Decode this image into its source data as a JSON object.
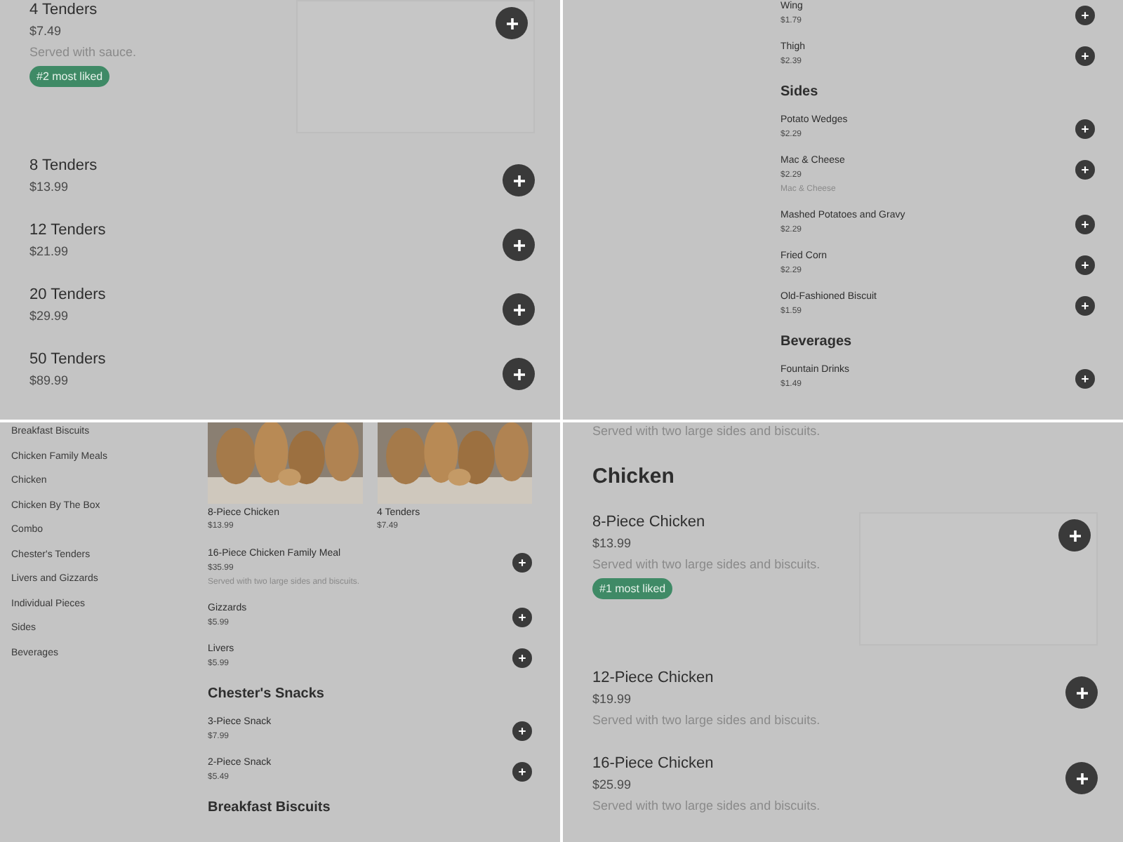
{
  "panels": [
    {
      "kind": "large",
      "sections": [
        {
          "kind": "list",
          "items": [
            {
              "name": "4 Tenders",
              "price": "$7.49",
              "description": "Served with sauce.",
              "badge": "#2 most liked",
              "image": true
            },
            {
              "name": "8 Tenders",
              "price": "$13.99"
            },
            {
              "name": "12 Tenders",
              "price": "$21.99"
            },
            {
              "name": "20 Tenders",
              "price": "$29.99"
            },
            {
              "name": "50 Tenders",
              "price": "$89.99"
            }
          ]
        }
      ]
    },
    {
      "kind": "small",
      "sections": [
        {
          "kind": "list",
          "items": [
            {
              "name": "Wing",
              "price": "$1.79"
            },
            {
              "name": "Thigh",
              "price": "$2.39"
            }
          ]
        },
        {
          "kind": "list",
          "title": "Sides",
          "items": [
            {
              "name": "Potato Wedges",
              "price": "$2.29"
            },
            {
              "name": "Mac & Cheese",
              "price": "$2.29",
              "description": "Mac & Cheese"
            },
            {
              "name": "Mashed Potatoes and Gravy",
              "price": "$2.29"
            },
            {
              "name": "Fried Corn",
              "price": "$2.29"
            },
            {
              "name": "Old-Fashioned Biscuit",
              "price": "$1.59"
            }
          ]
        },
        {
          "kind": "list",
          "title": "Beverages",
          "items": [
            {
              "name": "Fountain Drinks",
              "price": "$1.49"
            }
          ]
        }
      ]
    },
    {
      "kind": "small",
      "sidebar": [
        "Breakfast Biscuits",
        "Chicken Family Meals",
        "Chicken",
        "Chicken By The Box",
        "Combo",
        "Chester's Tenders",
        "Livers and Gizzards",
        "Individual Pieces",
        "Sides",
        "Beverages"
      ],
      "sections": [
        {
          "kind": "photos",
          "items": [
            {
              "name": "8-Piece Chicken",
              "price": "$13.99"
            },
            {
              "name": "4 Tenders",
              "price": "$7.49"
            }
          ]
        },
        {
          "kind": "list",
          "items": [
            {
              "name": "16-Piece Chicken Family Meal",
              "price": "$35.99",
              "description": "Served with two large sides and biscuits."
            },
            {
              "name": "Gizzards",
              "price": "$5.99"
            },
            {
              "name": "Livers",
              "price": "$5.99"
            }
          ]
        },
        {
          "kind": "list",
          "title": "Chester's Snacks",
          "items": [
            {
              "name": "3-Piece Snack",
              "price": "$7.99"
            },
            {
              "name": "2-Piece Snack",
              "price": "$5.49"
            }
          ]
        },
        {
          "kind": "list",
          "title": "Breakfast Biscuits"
        }
      ]
    },
    {
      "kind": "large",
      "sections": [
        {
          "kind": "note",
          "text": "Served with two large sides and biscuits."
        },
        {
          "kind": "list",
          "title": "Chicken",
          "items": [
            {
              "name": "8-Piece Chicken",
              "price": "$13.99",
              "description": "Served with two large sides and biscuits.",
              "badge": "#1 most liked",
              "image": true
            },
            {
              "name": "12-Piece Chicken",
              "price": "$19.99",
              "description": "Served with two large sides and biscuits."
            },
            {
              "name": "16-Piece Chicken",
              "price": "$25.99",
              "description": "Served with two large sides and biscuits."
            }
          ]
        }
      ]
    }
  ]
}
